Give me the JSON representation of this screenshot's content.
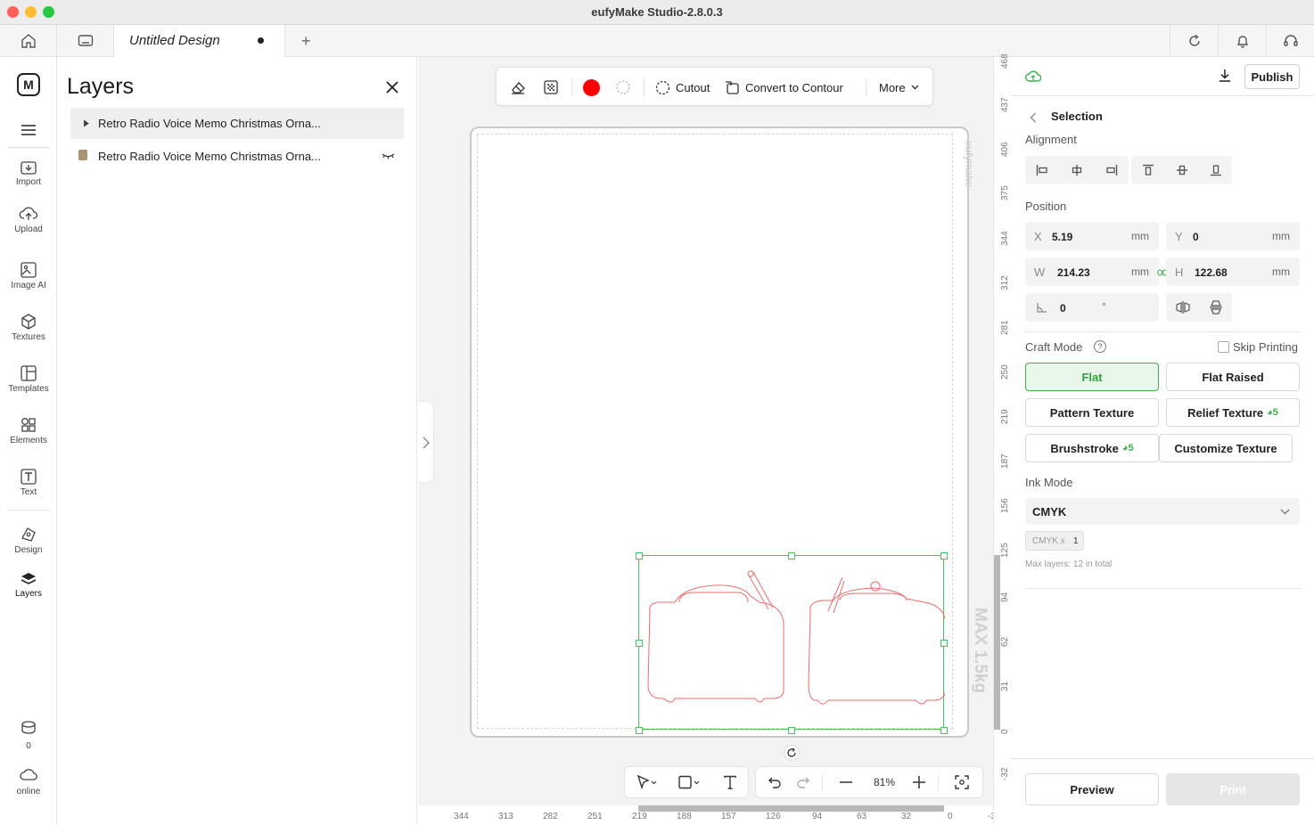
{
  "window": {
    "title": "eufyMake Studio-2.8.0.3"
  },
  "tabs": {
    "active_label": "Untitled Design"
  },
  "nav": {
    "items": [
      {
        "label": "Import"
      },
      {
        "label": "Upload"
      },
      {
        "label": "Image AI"
      },
      {
        "label": "Textures"
      },
      {
        "label": "Templates"
      },
      {
        "label": "Elements"
      },
      {
        "label": "Text"
      },
      {
        "label": "Design"
      },
      {
        "label": "Layers"
      }
    ],
    "credits": "0",
    "status": "online"
  },
  "layers": {
    "title": "Layers",
    "rows": [
      {
        "name": "Retro Radio Voice Memo Christmas Orna..."
      },
      {
        "name": "Retro Radio Voice Memo Christmas Orna..."
      }
    ]
  },
  "toolbar": {
    "cutout_label": "Cutout",
    "contour_label": "Convert to Contour",
    "more_label": "More",
    "color": "#ff0000"
  },
  "canvas": {
    "watermark": "eufymake",
    "max_weight": "MAX 1.5kg",
    "zoom": "81%",
    "h_ruler": [
      "344",
      "313",
      "282",
      "251",
      "219",
      "188",
      "157",
      "126",
      "94",
      "63",
      "32",
      "0",
      "-3"
    ],
    "v_ruler": [
      "468",
      "437",
      "406",
      "375",
      "344",
      "312",
      "281",
      "250",
      "219",
      "187",
      "156",
      "125",
      "94",
      "62",
      "31",
      "0",
      "-32"
    ]
  },
  "right": {
    "publish_label": "Publish",
    "section_title": "Selection",
    "alignment_label": "Alignment",
    "position_label": "Position",
    "x": {
      "key": "X",
      "value": "5.19",
      "unit": "mm"
    },
    "y": {
      "key": "Y",
      "value": "0",
      "unit": "mm"
    },
    "w": {
      "key": "W",
      "value": "214.23",
      "unit": "mm"
    },
    "h": {
      "key": "H",
      "value": "122.68",
      "unit": "mm"
    },
    "rotation": {
      "value": "0",
      "unit": "°"
    },
    "craft_mode_label": "Craft Mode",
    "skip_printing_label": "Skip Printing",
    "craft_buttons": {
      "flat": "Flat",
      "flat_raised": "Flat Raised",
      "pattern_texture": "Pattern Texture",
      "relief_texture": "Relief Texture",
      "relief_badge": "5",
      "brushstroke": "Brushstroke",
      "brush_badge": "5",
      "customize_texture": "Customize Texture"
    },
    "ink_mode_label": "Ink Mode",
    "ink_mode_value": "CMYK",
    "ink_chip_label": "CMYK x",
    "ink_chip_count": "1",
    "max_layers": "Max layers: 12 in total",
    "preview_label": "Preview",
    "print_label": "Print"
  },
  "colors": {
    "accent": "#3db04a",
    "selection": "#4cc25a",
    "outline": "#f06b6b"
  }
}
